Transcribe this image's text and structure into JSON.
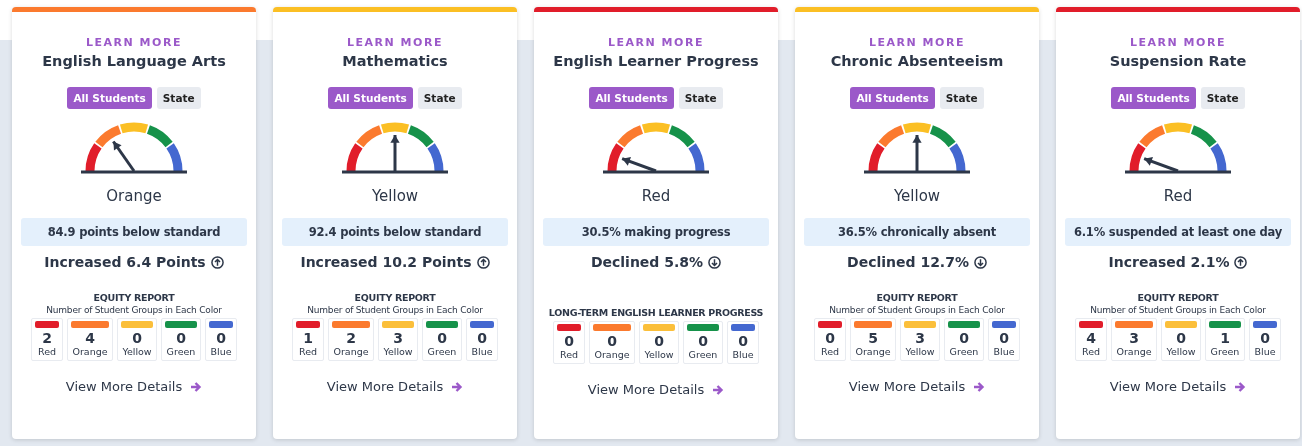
{
  "cards": [
    {
      "link": "LEARN MORE",
      "title": "English Language Arts",
      "tabs": [
        {
          "label": "All Students",
          "selected": true
        },
        {
          "label": "State",
          "selected": false
        }
      ],
      "kind": "orange",
      "rating_label": "Orange",
      "status": "84.9 points below standard",
      "change": {
        "text": "Increased 6.4 Points",
        "kind": "up"
      },
      "equity_title": "EQUITY REPORT",
      "equity_subtitle": "Number of Student Groups in Each Color",
      "counts": [
        {
          "count": "2",
          "label": "Red",
          "color": "#e11d2a"
        },
        {
          "count": "4",
          "label": "Orange",
          "color": "#fb7a2e"
        },
        {
          "count": "0",
          "label": "Yellow",
          "color": "#fbbf3a"
        },
        {
          "count": "0",
          "label": "Green",
          "color": "#16924a"
        },
        {
          "count": "0",
          "label": "Blue",
          "color": "#4468d0"
        }
      ],
      "details": "View More Details"
    },
    {
      "link": "LEARN MORE",
      "title": "Mathematics",
      "tabs": [
        {
          "label": "All Students",
          "selected": true
        },
        {
          "label": "State",
          "selected": false
        }
      ],
      "kind": "yellow",
      "rating_label": "Yellow",
      "status": "92.4 points below standard",
      "change": {
        "text": "Increased 10.2 Points",
        "kind": "up"
      },
      "equity_title": "EQUITY REPORT",
      "equity_subtitle": "Number of Student Groups in Each Color",
      "counts": [
        {
          "count": "1",
          "label": "Red",
          "color": "#e11d2a"
        },
        {
          "count": "2",
          "label": "Orange",
          "color": "#fb7a2e"
        },
        {
          "count": "3",
          "label": "Yellow",
          "color": "#fbbf3a"
        },
        {
          "count": "0",
          "label": "Green",
          "color": "#16924a"
        },
        {
          "count": "0",
          "label": "Blue",
          "color": "#4468d0"
        }
      ],
      "details": "View More Details"
    },
    {
      "link": "LEARN MORE",
      "title": "English Learner Progress",
      "tabs": [
        {
          "label": "All Students",
          "selected": true
        },
        {
          "label": "State",
          "selected": false
        }
      ],
      "kind": "red",
      "rating_label": "Red",
      "status": "30.5% making progress",
      "change": {
        "text": "Declined 5.8%",
        "kind": "down"
      },
      "equity_title": "LONG-TERM ENGLISH LEARNER PROGRESS",
      "counts": [
        {
          "count": "0",
          "label": "Red",
          "color": "#e11d2a"
        },
        {
          "count": "0",
          "label": "Orange",
          "color": "#fb7a2e"
        },
        {
          "count": "0",
          "label": "Yellow",
          "color": "#fbbf3a"
        },
        {
          "count": "0",
          "label": "Green",
          "color": "#16924a"
        },
        {
          "count": "0",
          "label": "Blue",
          "color": "#4468d0"
        }
      ],
      "details": "View More Details"
    },
    {
      "link": "LEARN MORE",
      "title": "Chronic Absenteeism",
      "tabs": [
        {
          "label": "All Students",
          "selected": true
        },
        {
          "label": "State",
          "selected": false
        }
      ],
      "kind": "yellow",
      "rating_label": "Yellow",
      "status": "36.5% chronically absent",
      "change": {
        "text": "Declined 12.7%",
        "kind": "down"
      },
      "equity_title": "EQUITY REPORT",
      "equity_subtitle": "Number of Student Groups in Each Color",
      "counts": [
        {
          "count": "0",
          "label": "Red",
          "color": "#e11d2a"
        },
        {
          "count": "5",
          "label": "Orange",
          "color": "#fb7a2e"
        },
        {
          "count": "3",
          "label": "Yellow",
          "color": "#fbbf3a"
        },
        {
          "count": "0",
          "label": "Green",
          "color": "#16924a"
        },
        {
          "count": "0",
          "label": "Blue",
          "color": "#4468d0"
        }
      ],
      "details": "View More Details"
    },
    {
      "link": "LEARN MORE",
      "title": "Suspension Rate",
      "tabs": [
        {
          "label": "All Students",
          "selected": true
        },
        {
          "label": "State",
          "selected": false
        }
      ],
      "kind": "red",
      "rating_label": "Red",
      "status": "6.1% suspended at least one day",
      "change": {
        "text": "Increased 2.1%",
        "kind": "up"
      },
      "equity_title": "EQUITY REPORT",
      "equity_subtitle": "Number of Student Groups in Each Color",
      "counts": [
        {
          "count": "4",
          "label": "Red",
          "color": "#e11d2a"
        },
        {
          "count": "3",
          "label": "Orange",
          "color": "#fb7a2e"
        },
        {
          "count": "0",
          "label": "Yellow",
          "color": "#fbbf3a"
        },
        {
          "count": "1",
          "label": "Green",
          "color": "#16924a"
        },
        {
          "count": "0",
          "label": "Blue",
          "color": "#4468d0"
        }
      ],
      "details": "View More Details"
    }
  ]
}
